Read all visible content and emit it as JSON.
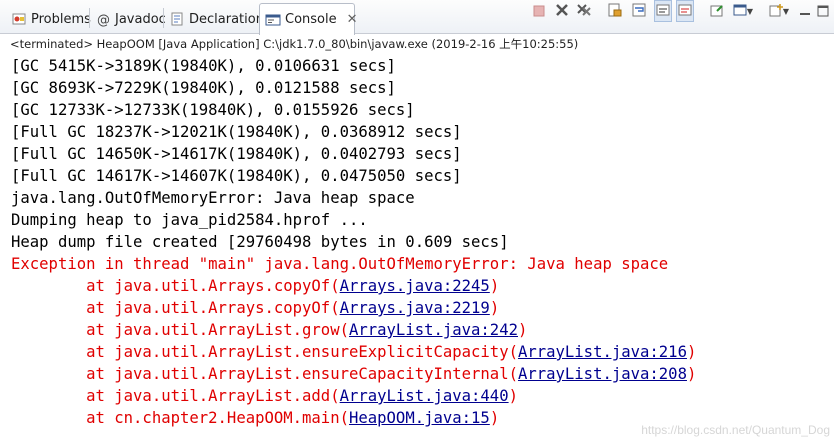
{
  "tabs": [
    {
      "label": "Problems",
      "icon": "problems-icon",
      "active": false
    },
    {
      "label": "Javadoc",
      "icon": "javadoc-icon",
      "active": false
    },
    {
      "label": "Declaration",
      "icon": "declaration-icon",
      "active": false
    },
    {
      "label": "Console",
      "icon": "console-icon",
      "active": true,
      "close": "✕"
    }
  ],
  "toolbar": {
    "icons": [
      "terminate-icon",
      "remove-launch-icon",
      "remove-all-terminated-icon",
      "scroll-lock-icon",
      "word-wrap-icon",
      "show-stdout-icon",
      "show-stderr-icon",
      "pin-console-icon",
      "display-console-icon",
      "new-console-icon",
      "view-menu-icon",
      "minimize-icon",
      "maximize-icon"
    ]
  },
  "status": "<terminated> HeapOOM [Java Application] C:\\jdk1.7.0_80\\bin\\javaw.exe (2019-2-16 上午10:25:55)",
  "console": {
    "stdout": [
      "[GC 5415K->3189K(19840K), 0.0106631 secs]",
      "[GC 8693K->7229K(19840K), 0.0121588 secs]",
      "[GC 12733K->12733K(19840K), 0.0155926 secs]",
      "[Full GC 18237K->12021K(19840K), 0.0368912 secs]",
      "[Full GC 14650K->14617K(19840K), 0.0402793 secs]",
      "[Full GC 14617K->14607K(19840K), 0.0475050 secs]",
      "java.lang.OutOfMemoryError: Java heap space",
      "Dumping heap to java_pid2584.hprof ...",
      "Heap dump file created [29760498 bytes in 0.609 secs]"
    ],
    "exception": "Exception in thread \"main\" java.lang.OutOfMemoryError: Java heap space",
    "stack": [
      {
        "prefix": "        at java.util.Arrays.copyOf(",
        "link": "Arrays.java:2245",
        "suffix": ")"
      },
      {
        "prefix": "        at java.util.Arrays.copyOf(",
        "link": "Arrays.java:2219",
        "suffix": ")"
      },
      {
        "prefix": "        at java.util.ArrayList.grow(",
        "link": "ArrayList.java:242",
        "suffix": ")"
      },
      {
        "prefix": "        at java.util.ArrayList.ensureExplicitCapacity(",
        "link": "ArrayList.java:216",
        "suffix": ")"
      },
      {
        "prefix": "        at java.util.ArrayList.ensureCapacityInternal(",
        "link": "ArrayList.java:208",
        "suffix": ")"
      },
      {
        "prefix": "        at java.util.ArrayList.add(",
        "link": "ArrayList.java:440",
        "suffix": ")"
      },
      {
        "prefix": "        at cn.chapter2.HeapOOM.main(",
        "link": "HeapOOM.java:15",
        "suffix": ")"
      }
    ]
  },
  "watermark": "https://blog.csdn.net/Quantum_Dog",
  "colors": {
    "stdout": "#000000",
    "stderr": "#e00000",
    "link": "#00008f"
  }
}
